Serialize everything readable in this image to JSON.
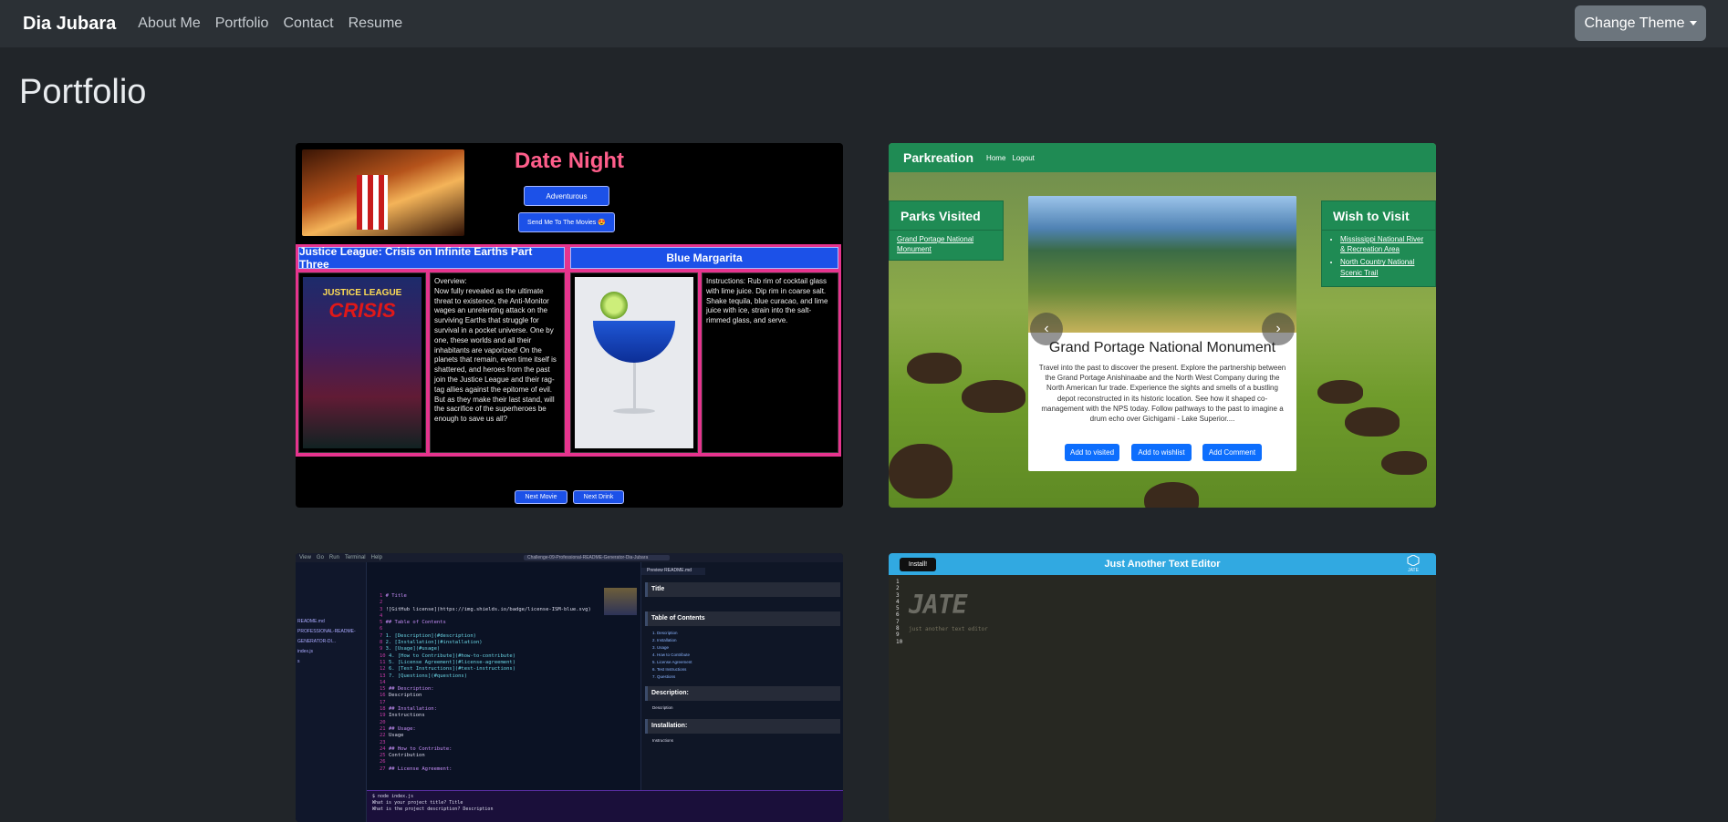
{
  "navbar": {
    "brand": "Dia Jubara",
    "links": [
      "About Me",
      "Portfolio",
      "Contact",
      "Resume"
    ],
    "theme_button": "Change Theme"
  },
  "page_title": "Portfolio",
  "projects": {
    "date_night": {
      "title": "Date Night",
      "select_value": "Adventurous",
      "send_button": "Send Me To The Movies 😍",
      "movie_title": "Justice League: Crisis on Infinite Earths Part Three",
      "poster_top": "JUSTICE LEAGUE",
      "poster_main": "CRISIS",
      "movie_overview": "Overview:\nNow fully revealed as the ultimate threat to existence, the Anti-Monitor wages an unrelenting attack on the surviving Earths that struggle for survival in a pocket universe. One by one, these worlds and all their inhabitants are vaporized! On the planets that remain, even time itself is shattered, and heroes from the past join the Justice League and their rag-tag allies against the epitome of evil. But as they make their last stand, will the sacrifice of the superheroes be enough to save us all?",
      "drink_title": "Blue Margarita",
      "drink_instructions": "Instructions: Rub rim of cocktail glass with lime juice. Dip rim in coarse salt. Shake tequila, blue curacao, and lime juice with ice, strain into the salt-rimmed glass, and serve.",
      "next_movie": "Next Movie",
      "next_drink": "Next Drink"
    },
    "parkreation": {
      "brand": "Parkreation",
      "nav_links": [
        "Home",
        "Logout"
      ],
      "visited_title": "Parks Visited",
      "visited_items": [
        "Grand Portage National Monument"
      ],
      "wish_title": "Wish to Visit",
      "wish_items": [
        "Mississippi National River & Recreation Area",
        "North Country National Scenic Trail"
      ],
      "park_title": "Grand Portage National Monument",
      "park_description": "Travel into the past to discover the present. Explore the partnership between the Grand Portage Anishinaabe and the North West Company during the North American fur trade. Experience the sights and smells of a bustling depot reconstructed in its historic location. See how it shaped co-management with the NPS today. Follow pathways to the past to imagine a drum echo over Gichigami - Lake Superior....",
      "buttons": [
        "Add to visited",
        "Add to wishlist",
        "Add Comment"
      ],
      "prev_glyph": "‹",
      "next_glyph": "›"
    },
    "readme": {
      "menu": [
        "View",
        "Go",
        "Run",
        "Terminal",
        "Help"
      ],
      "search_text": "Challenge-09-Professional-README-Generator-Dia-Jubara",
      "sidebar_items": [
        "README.md",
        "PROFESSIONAL-README-GENERATOR-DI...",
        "index.js",
        "s"
      ],
      "editor_lines": [
        "# Title",
        "",
        "![GitHub license](https://img.shields.io/badge/license-ISM-blue.svg)",
        "",
        "## Table of Contents",
        "",
        "1. [Description](#description)",
        "2. [Installation](#installation)",
        "3. [Usage](#usage)",
        "4. [How to Contribute](#how-to-contribute)",
        "5. [License Agreement](#license-agreement)",
        "6. [Test Instructions](#test-instructions)",
        "7. [Questions](#questions)",
        "",
        "## Description:",
        "Description",
        "",
        "## Installation:",
        "Instructions",
        "",
        "## Usage:",
        "Usage",
        "",
        "## How to Contribute:",
        "Contribution",
        "",
        "## License Agreement:"
      ],
      "preview_tab": "Preview README.md",
      "preview_title": "Title",
      "preview_toc": "Table of Contents",
      "preview_toc_items": [
        "Description",
        "Installation",
        "Usage",
        "How to Contribute",
        "License Agreement",
        "Test Instructions",
        "Questions"
      ],
      "preview_description": "Description:",
      "preview_description_text": "Description",
      "preview_installation": "Installation:",
      "preview_installation_text": "Instructions",
      "terminal_lines": [
        "$ node index.js",
        "What is your project title? Title",
        "What is the project description? Description"
      ]
    },
    "jate": {
      "install_button": "Install!",
      "title": "Just Another Text Editor",
      "logo_text": "JATE",
      "line_numbers": [
        "1",
        "2",
        "3",
        "4",
        "5",
        "6",
        "7",
        "8",
        "9",
        "10"
      ],
      "ascii_logo": "JATE",
      "subtitle": "just another text editor"
    }
  }
}
